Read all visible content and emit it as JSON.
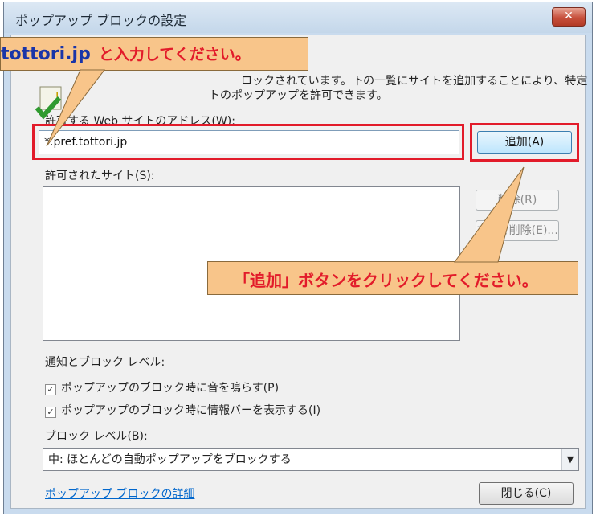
{
  "window": {
    "title": "ポップアップ ブロックの設定",
    "close_glyph": "✕"
  },
  "info": {
    "line1": "ロックされています。下の一覧にサイトを追加することにより、特定",
    "line2": "トのポップアップを許可できます。"
  },
  "address": {
    "label": "許可する Web サイトのアドレス(W):",
    "value": "*.pref.tottori.jp",
    "add_button": "追加(A)"
  },
  "allowed": {
    "label": "許可されたサイト(S):",
    "remove_button": "削除(R)",
    "remove_all_button": "すべて削除(E)..."
  },
  "notify": {
    "label": "通知とブロック レベル:",
    "option_sound": "ポップアップのブロック時に音を鳴らす(P)",
    "option_infobar": "ポップアップのブロック時に情報バーを表示する(I)",
    "level_label": "ブロック レベル(B):",
    "level_value": "中: ほとんどの自動ポップアップをブロックする",
    "level_arrow": "▼"
  },
  "footer": {
    "link": "ポップアップ ブロックの詳細",
    "close_button": "閉じる(C)"
  },
  "callouts": {
    "top_code": "tottori.jp",
    "top_message": "と入力してください。",
    "bottom_message": "「追加」ボタンをクリックしてください。"
  },
  "colors": {
    "highlight_red": "#e21b2a",
    "callout_bg": "#f8c58a"
  }
}
